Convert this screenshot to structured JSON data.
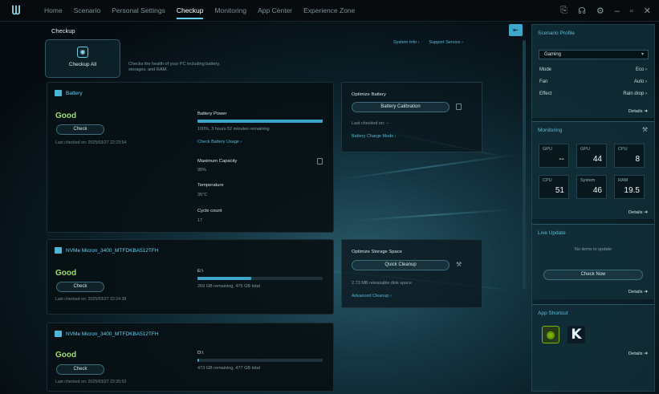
{
  "nav": [
    "Home",
    "Scenario",
    "Personal Settings",
    "Checkup",
    "Monitoring",
    "App Center",
    "Experience Zone"
  ],
  "page_title": "Checkup",
  "checkup_all": {
    "label": "Checkup All",
    "description": "Checks the health of your PC including battery, storages, and RAM."
  },
  "top_links": {
    "system_info": "System Info ›",
    "support": "Support Service ›"
  },
  "battery": {
    "title": "Battery",
    "status": "Good",
    "check": "Check",
    "last_checked": "Last checked on: 2025/03/27 22:23:54",
    "power_label": "Battery Power",
    "power_value": "100%, 3 hours 52 minutes remaining",
    "power_progress": 1.0,
    "usage_link": "Check Battery Usage ›",
    "capacity_label": "Maximum Capacity",
    "capacity_value": "95%",
    "temp_label": "Temperature",
    "temp_value": "35°C",
    "cycle_label": "Cycle count",
    "cycle_value": "17"
  },
  "opt_battery": {
    "title": "Optimize Battery",
    "button": "Battery Calibration",
    "last": "Last checked on: --",
    "link": "Battery Charge Mode ›"
  },
  "storage1": {
    "title": "NVMe Micron_3400_MTFDKBA512TFH",
    "status": "Good",
    "check": "Check",
    "last_checked": "Last checked on: 2025/03/27 22:24:38",
    "drive": "E:\\",
    "value": "269 GB remaining, 475 GB total",
    "progress": 0.43
  },
  "opt_storage": {
    "title": "Optimize Storage Space",
    "button": "Quick Cleanup",
    "space": "2.73 MB releasable disk space",
    "link": "Advanced Cleanup ›"
  },
  "storage2": {
    "title": "NVMe Micron_3400_MTFDKBA512TFH",
    "status": "Good",
    "check": "Check",
    "last_checked": "Last checked on: 2025/03/27 22:25:53",
    "drive": "D:\\",
    "value": "473 GB remaining, 477 GB total",
    "progress": 0.01
  },
  "side": {
    "scenario_title": "Scenario Profile",
    "profile": "Gaming",
    "mode_label": "Mode",
    "mode_value": "Eco ›",
    "fan_label": "Fan",
    "fan_value": "Auto ›",
    "effect_label": "Effect",
    "effect_value": "Rain drop ›",
    "details": "Details",
    "monitoring_title": "Monitoring",
    "metrics": [
      {
        "name": "GPU",
        "value": "--"
      },
      {
        "name": "GPU",
        "value": "44"
      },
      {
        "name": "CPU",
        "value": "8"
      },
      {
        "name": "CPU",
        "value": "51"
      },
      {
        "name": "System",
        "value": "46"
      },
      {
        "name": "RAM",
        "value": "19.5"
      }
    ],
    "live_title": "Live Update",
    "live_msg": "No items to update",
    "check_now": "Check Now",
    "shortcut_title": "App Shortcut"
  }
}
